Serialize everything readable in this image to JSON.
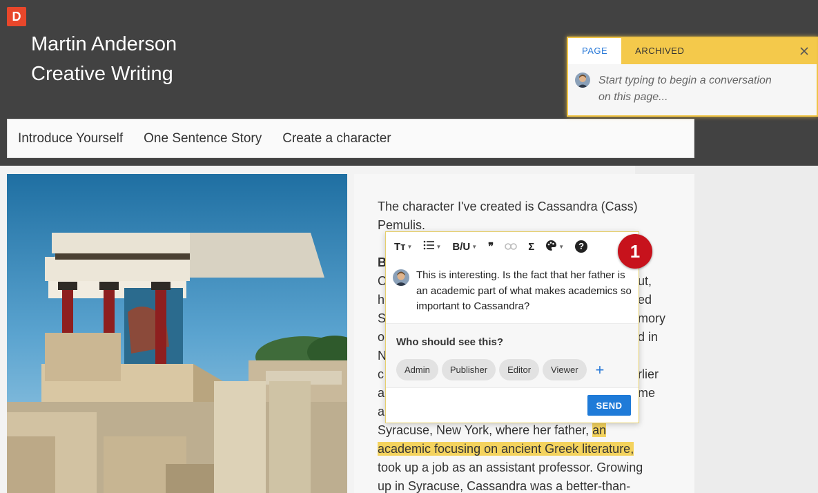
{
  "app": {
    "logo_letter": "D"
  },
  "header": {
    "title_line1": "Martin Anderson",
    "title_line2": "Creative Writing"
  },
  "nav": {
    "items": [
      {
        "label": "Introduce Yourself"
      },
      {
        "label": "One Sentence Story"
      },
      {
        "label": "Create a character"
      }
    ]
  },
  "content": {
    "intro_line1": "The character I've created is Cassandra (Cass)",
    "intro_line2": "Pemulis.",
    "hidden_start": "B",
    "hidden_lines": [
      "C",
      "h",
      "S",
      "o",
      "N",
      "c",
      "a",
      "a"
    ],
    "hidden_right": [
      "ut,",
      "ed",
      "mory",
      "d in",
      "rlier",
      "me"
    ],
    "para2_line1_pre": "Syracuse, New York, where her father, ",
    "para2_line1_hl": "an",
    "para2_line2_hl": "academic focusing on ancient Greek literature,",
    "para2_line3": "took up a job as an assistant professor. Growing",
    "para2_line4": "up in Syracuse, Cassandra was a better-than-"
  },
  "comment_panel": {
    "tab_page": "PAGE",
    "tab_archived": "ARCHIVED",
    "placeholder": "Start typing to begin a conversation on this page..."
  },
  "comment_popup": {
    "toolbar": {
      "text_style": "Tт",
      "bold_italic_underline": "B/U",
      "quote": "❞",
      "sigma": "Σ",
      "help": "?"
    },
    "badge": "1",
    "comment_text": "This is interesting. Is the fact that her father is an academic part of what makes academics so important to Cassandra?",
    "audience_label": "Who should see this?",
    "audience_options": [
      "Admin",
      "Publisher",
      "Editor",
      "Viewer"
    ],
    "add_label": "+",
    "send_label": "SEND"
  },
  "colors": {
    "header_bg": "#424242",
    "logo": "#e8472b",
    "accent_yellow": "#f4c94b",
    "primary_blue": "#1f7bd8",
    "badge_red": "#c7121c",
    "highlight": "#f4d35e"
  }
}
